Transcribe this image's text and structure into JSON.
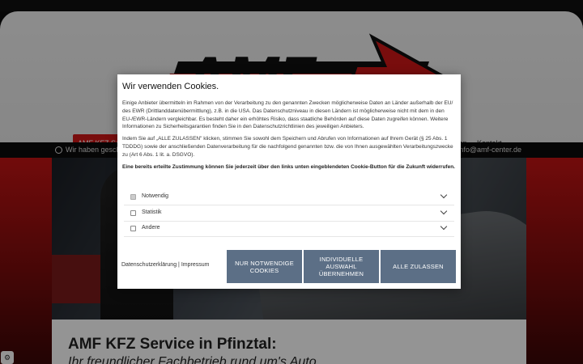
{
  "site": {
    "logo_text": "AMF",
    "nav": {
      "items": [
        "AMF KFZ Service",
        "zen",
        "Kontakt"
      ]
    },
    "info_bar": {
      "left_text": "Wir haben gesch",
      "right_text": "info@amf-center.de"
    },
    "content": {
      "title": "AMF KFZ Service in Pfinztal:",
      "subtitle": "Ihr freundlicher Fachbetrieb rund um's Auto"
    }
  },
  "cookie_modal": {
    "title": "Wir verwenden Cookies.",
    "paragraphs": [
      "Einige Anbieter übermitteln im Rahmen von der Verarbeitung zu den genannten Zwecken möglicherweise Daten an Länder außerhalb der EU/ des EWR (Drittlanddatenübermittlung), z.B. in die USA. Das Datenschutzniveau in diesen Ländern ist möglicherweise nicht mit dem in den EU-/EWR-Ländern vergleichbar. Es besteht daher ein erhöhtes Risiko, dass staatliche Behörden auf diese Daten zugreifen können. Weitere Informationen zu Sicherheitsgarantien finden Sie in den Datenschutzrichtlinien des jeweiligen Anbieters.",
      "Indem Sie auf „ALLE ZULASSEN\" klicken, stimmen Sie sowohl dem Speichern und Abrufen von Informationen auf Ihrem Gerät (§ 25 Abs. 1 TDDDG) sowie der anschließenden Datenverarbeitung für die nachfolgend genannten bzw. die von Ihnen ausgewählten Verarbeitungszwecke zu (Art 6 Abs. 1 lit. a. DSGVO)."
    ],
    "revoke_note": "Eine bereits erteilte Zustimmung können Sie jederzeit über den links unten eingeblendeten Cookie-Button für die Zukunft widerrufen.",
    "categories": [
      {
        "label": "Notwendig",
        "checked": true
      },
      {
        "label": "Statistik",
        "checked": false
      },
      {
        "label": "Andere",
        "checked": false
      }
    ],
    "links": {
      "privacy": "Datenschutzerklärung",
      "separator": "|",
      "imprint": "Impressum"
    },
    "buttons": {
      "necessary": "NUR NOTWENDIGE COOKIES",
      "individual": "INDIVIDUELLE AUSWAHL ÜBERNEHMEN",
      "accept_all": "ALLE ZULASSEN"
    },
    "button_color": "#5c6f86"
  },
  "colors": {
    "brand_red": "#d01818",
    "nav_active": "#d01818"
  },
  "icons": [
    "clock-icon",
    "chevron-down-icon",
    "cookie-settings-icon",
    "checkbox-icon"
  ]
}
